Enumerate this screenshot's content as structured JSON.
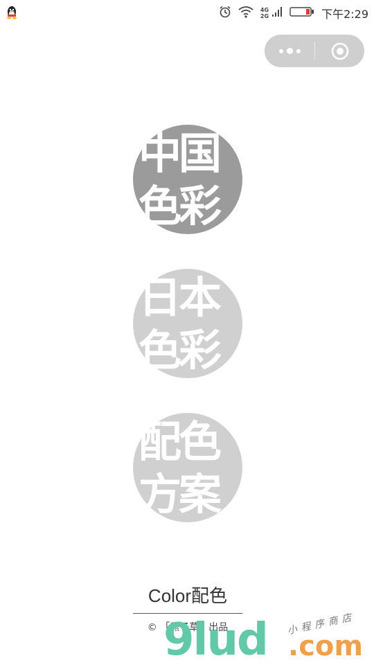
{
  "status_bar": {
    "app_icon": "qq-penguin-icon",
    "alarm_icon": "alarm-clock-icon",
    "wifi_icon": "wifi-icon",
    "network_top": "4G",
    "network_bottom": "2G",
    "battery_icon": "battery-low-icon",
    "battery_color": "#e53935",
    "time": "下午2:29"
  },
  "capsule": {
    "more_icon": "more-dots-icon",
    "close_icon": "target-close-icon"
  },
  "menu": {
    "items": [
      {
        "label": "中国\n色彩",
        "color": "#9b9b9b"
      },
      {
        "label": "日本\n色彩",
        "color": "#d0d0d0"
      },
      {
        "label": "配色\n方案",
        "color": "#d0d0d0"
      }
    ]
  },
  "footer": {
    "title": "Color配色",
    "subtitle": "© 「黑子草」出品"
  },
  "watermark": {
    "main": "9lud",
    "dot_com": ".com",
    "tagline": "小程序商店"
  }
}
